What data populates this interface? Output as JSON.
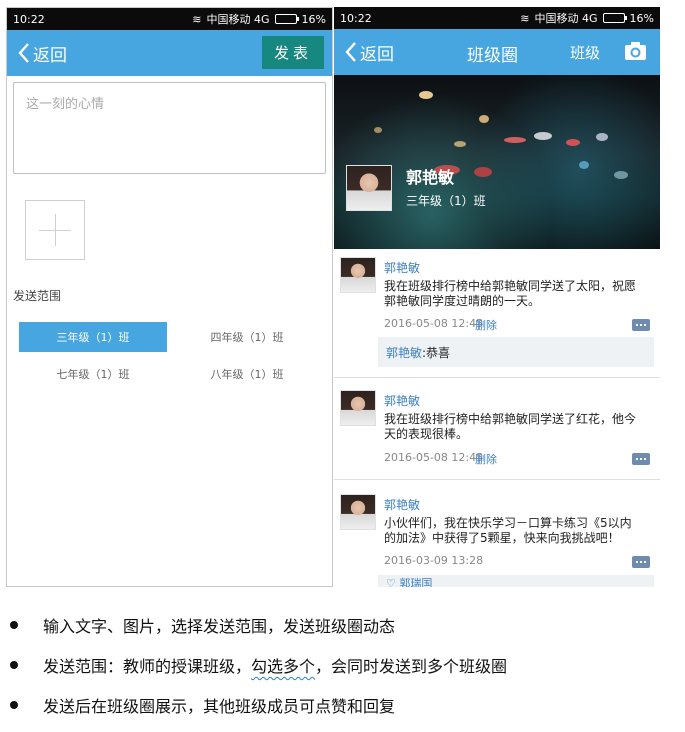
{
  "status_bar": {
    "time": "10:22",
    "carrier": "中国移动 4G",
    "battery": "16%"
  },
  "compose_screen": {
    "back_label": "返回",
    "publish_label": "发表",
    "mood_placeholder": "这一刻的心情",
    "range_label": "发送范围",
    "class_options": [
      {
        "label": "三年级（1）班",
        "selected": true
      },
      {
        "label": "四年级（1）班",
        "selected": false
      },
      {
        "label": "七年级（1）班",
        "selected": false
      },
      {
        "label": "八年级（1）班",
        "selected": false
      }
    ]
  },
  "circle_screen": {
    "back_label": "返回",
    "title": "班级圈",
    "class_button": "班级",
    "profile": {
      "name": "郭艳敏",
      "class": "三年级（1）班"
    },
    "posts": [
      {
        "author": "郭艳敏",
        "text_line1": "我在班级排行榜中给郭艳敏同学送了太阳，祝愿",
        "text_line2": "郭艳敏同学度过晴朗的一天。",
        "time": "2016-05-08 12:45",
        "delete_label": "删除",
        "reply_author": "郭艳敏",
        "reply_text": ":恭喜"
      },
      {
        "author": "郭艳敏",
        "text_line1": "我在班级排行榜中给郭艳敏同学送了红花，他今",
        "text_line2": "天的表现很棒。",
        "time": "2016-05-08 12:45",
        "delete_label": "删除"
      },
      {
        "author": "郭艳敏",
        "text_line1": "小伙伴们，我在快乐学习－口算卡练习《5以内",
        "text_line2": "的加法》中获得了5颗星，快来向我挑战吧！",
        "time": "2016-03-09 13:28",
        "like_label": "郭瑞国"
      }
    ]
  },
  "bullets": [
    "输入文字、图片，选择发送范围，发送班级圈动态",
    {
      "before": "发送范围：教师的授课班级，",
      "emphasis": "勾选多个",
      "after": "，会同时发送到多个班级圈"
    },
    "发送后在班级圈展示，其他班级成员可点赞和回复"
  ],
  "colors": {
    "header": "#47a6e0",
    "publish_button": "#17887f",
    "link": "#3b7fc0"
  }
}
